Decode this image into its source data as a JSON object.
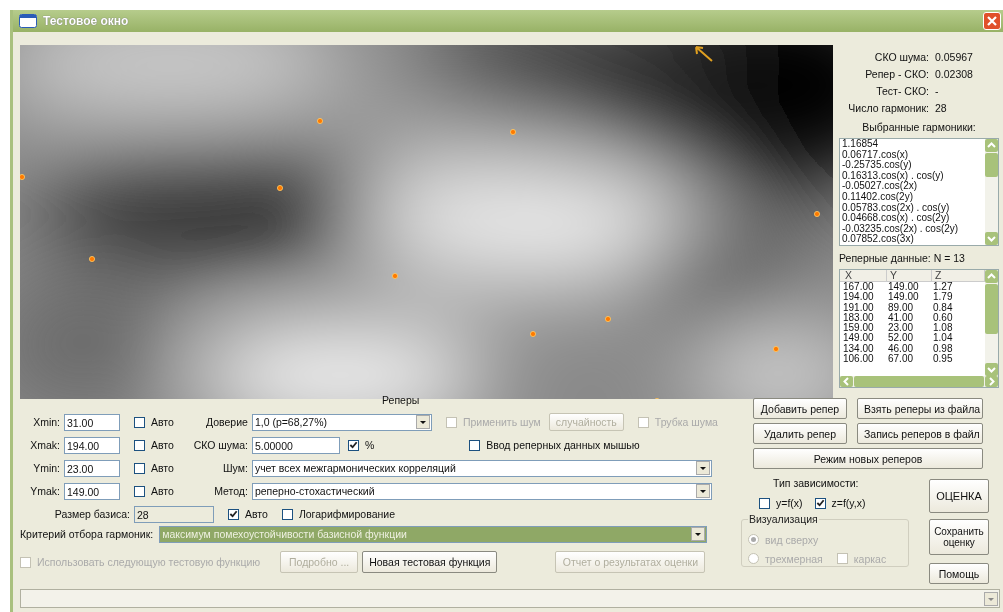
{
  "window": {
    "title": "Тестовое окно"
  },
  "stats": [
    {
      "label": "СКО шума:",
      "value": "0.05967"
    },
    {
      "label": "Репер - СКО:",
      "value": "0.02308"
    },
    {
      "label": "Тест- СКО:",
      "value": "-"
    },
    {
      "label": "Число гармоник:",
      "value": "28"
    }
  ],
  "harmonics": {
    "title": "Выбранные гармоники:",
    "items": [
      "1.16854",
      "0.06717.cos(x)",
      "-0.25735.cos(y)",
      "0.16313.cos(x) . cos(y)",
      "-0.05027.cos(2x)",
      "0.11402.cos(2y)",
      "0.05783.cos(2x) . cos(y)",
      "0.04668.cos(x) . cos(2y)",
      "-0.03235.cos(2x) . cos(2y)",
      "0.07852.cos(3x)"
    ]
  },
  "reference_data": {
    "title": "Реперные данные: N = 13",
    "columns": [
      "X",
      "Y",
      "Z"
    ],
    "rows": [
      [
        "167.00",
        "149.00",
        "1.27"
      ],
      [
        "194.00",
        "149.00",
        "1.79"
      ],
      [
        "191.00",
        "89.00",
        "0.84"
      ],
      [
        "183.00",
        "41.00",
        "0.60"
      ],
      [
        "159.00",
        "23.00",
        "1.08"
      ],
      [
        "149.00",
        "52.00",
        "1.04"
      ],
      [
        "134.00",
        "46.00",
        "0.98"
      ],
      [
        "106.00",
        "67.00",
        "0.95"
      ]
    ]
  },
  "markers_label": "Реперы",
  "ranges": [
    {
      "label": "Xmin:",
      "value": "31.00",
      "auto": {
        "label": "Авто",
        "checked": false
      }
    },
    {
      "label": "Xmak:",
      "value": "194.00",
      "auto": {
        "label": "Авто",
        "checked": false
      }
    },
    {
      "label": "Ymin:",
      "value": "23.00",
      "auto": {
        "label": "Авто",
        "checked": false
      }
    },
    {
      "label": "Ymak:",
      "value": "149.00",
      "auto": {
        "label": "Авто",
        "checked": false
      }
    }
  ],
  "confidence": {
    "label": "Доверие",
    "value": "1,0 (p=68,27%)"
  },
  "noise_sko": {
    "label": "СКО шума:",
    "value": "5.00000",
    "percent": {
      "label": "%",
      "checked": true
    }
  },
  "noise": {
    "label": "Шум:",
    "value": "учет всех межгармонических корреляций"
  },
  "method": {
    "label": "Метод:",
    "value": "реперно-стохастический"
  },
  "basis": {
    "label": "Размер базиса:",
    "value": "28",
    "auto": {
      "label": "Авто",
      "checked": true
    }
  },
  "log": {
    "label": "Логарифмирование",
    "checked": false
  },
  "apply_noise": {
    "label": "Применить шум",
    "checked": false,
    "disabled": true
  },
  "random_button": {
    "label": "случайность",
    "disabled": true
  },
  "noise_tube": {
    "label": "Трубка шума",
    "checked": false,
    "disabled": true
  },
  "mouse_input": {
    "label": "Ввод реперных данных мышью",
    "checked": false
  },
  "criterion": {
    "label": "Критерий отбора гармоник:",
    "value": "максимум помехоустойчивости базисной функции"
  },
  "use_next": {
    "label": "Использовать следующую тестовую функцию",
    "checked": false,
    "disabled": true
  },
  "action_buttons": [
    {
      "label": "Подробно ...",
      "disabled": true
    },
    {
      "label": "Новая тестовая функция",
      "disabled": false
    },
    {
      "label": "Отчет о результатах оценки",
      "disabled": true
    }
  ],
  "marker_buttons": [
    "Добавить репер",
    "Взять реперы из файла",
    "Удалить репер",
    "Запись реперов в файл"
  ],
  "mode_button": "Режим новых реперов",
  "dependency": {
    "title": "Тип зависимости:",
    "options": [
      {
        "label": "y=f(x)",
        "checked": false
      },
      {
        "label": "z=f(y,x)",
        "checked": true
      }
    ]
  },
  "visualization": {
    "title": "Визуализация",
    "disabled": true,
    "views": [
      {
        "label": "вид сверху",
        "selected": true
      },
      {
        "label": "трехмерная",
        "selected": false
      }
    ],
    "frame": {
      "label": "каркас",
      "checked": false
    }
  },
  "main_buttons": [
    "ОЦЕНКА",
    "Сохранить оценку",
    "Помощь"
  ]
}
